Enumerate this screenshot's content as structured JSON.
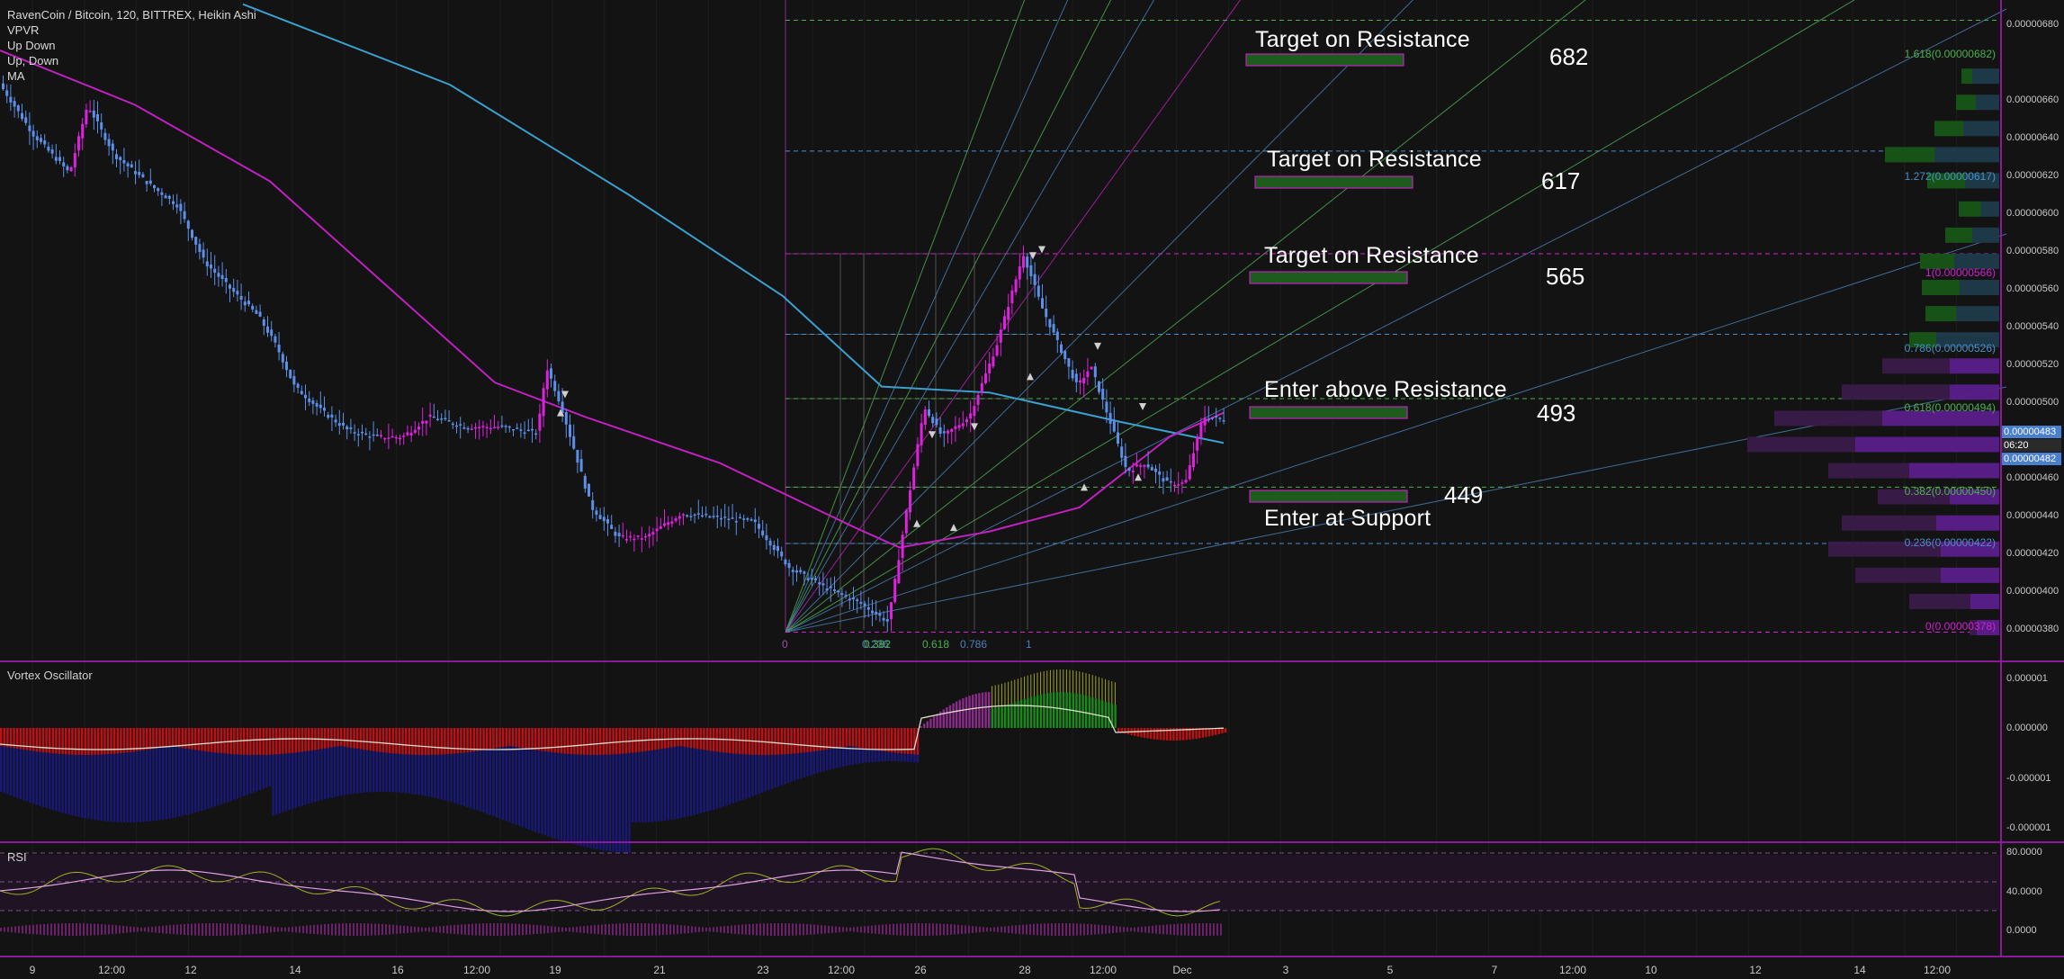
{
  "title": "RavenCoin / Bitcoin, 120, BITTREX, Heikin Ashi",
  "indicators": [
    "VPVR",
    "Up Down",
    "Up, Down",
    "MA"
  ],
  "panels": {
    "vortex": "Vortex Oscillator",
    "rsi": "RSI"
  },
  "annotations": [
    {
      "text": "Target on Resistance",
      "value": "682"
    },
    {
      "text": "Target on Resistance",
      "value": "617"
    },
    {
      "text": "Target on Resistance",
      "value": "565"
    },
    {
      "text": "Enter above Resistance",
      "value": "493"
    },
    {
      "text": "Enter at Support",
      "value": "449"
    }
  ],
  "fib_levels": [
    {
      "label": "1.618(0.00000682)",
      "price": 682,
      "color": "#4caf50"
    },
    {
      "label": "1.272(0.00000617)",
      "price": 617,
      "color": "#4a90c8"
    },
    {
      "label": "1(0.00000566)",
      "price": 566,
      "color": "#d020d0"
    },
    {
      "label": "0.786(0.00000526)",
      "price": 526,
      "color": "#4a90c8"
    },
    {
      "label": "0.618(0.00000494)",
      "price": 494,
      "color": "#4caf50"
    },
    {
      "label": "0.382(0.00000450)",
      "price": 450,
      "color": "#4caf50"
    },
    {
      "label": "0.236(0.00000422)",
      "price": 422,
      "color": "#4a90c8"
    },
    {
      "label": "0(0.00000378)",
      "price": 378,
      "color": "#d020d0"
    }
  ],
  "fan_labels": [
    "0",
    "0.236",
    "0.382",
    "0.618",
    "0.786",
    "1"
  ],
  "price_axis": [
    "0.00000680",
    "0.00000660",
    "0.00000640",
    "0.00000620",
    "0.00000600",
    "0.00000580",
    "0.00000560",
    "0.00000540",
    "0.00000520",
    "0.00000500",
    "0.00000460",
    "0.00000440",
    "0.00000420",
    "0.00000400",
    "0.00000380"
  ],
  "price_tags": {
    "last": "0.00000483",
    "timer": "06:20",
    "prev": "0.00000482"
  },
  "vortex_axis": [
    "0.000001",
    "0.000000",
    "-0.000001",
    "-0.000001"
  ],
  "rsi_axis": [
    "80.0000",
    "40.0000",
    "0.0000"
  ],
  "date_axis": [
    "9",
    "12:00",
    "12",
    "14",
    "16",
    "12:00",
    "19",
    "21",
    "23",
    "12:00",
    "26",
    "28",
    "12:00",
    "Dec",
    "3",
    "5",
    "7",
    "12:00",
    "10",
    "12",
    "14",
    "12:00"
  ],
  "colors": {
    "bull": "#e020e0",
    "bear": "#5b8fe8",
    "ma_slow": "#3aa0d0",
    "ma_fast": "#c020c0",
    "vortex_pos": "#1a8a1a",
    "vortex_neg_red": "#c01010",
    "vortex_neg_blue": "#18187a",
    "separator": "#8a1a9a"
  },
  "chart_data": {
    "type": "candlestick",
    "title": "RavenCoin / Bitcoin, 120, BITTREX, Heikin Ashi",
    "ylim": [
      372,
      696
    ],
    "y_unit": "satoshi (x 0.00000001 BTC)",
    "x": [
      "9",
      "12:00",
      "12",
      "14",
      "16",
      "12:00",
      "19",
      "21",
      "23",
      "12:00",
      "26",
      "28",
      "12:00",
      "Dec"
    ],
    "close_path": [
      [
        0,
        652
      ],
      [
        40,
        625
      ],
      [
        80,
        606
      ],
      [
        100,
        640
      ],
      [
        130,
        615
      ],
      [
        170,
        600
      ],
      [
        200,
        590
      ],
      [
        230,
        562
      ],
      [
        260,
        548
      ],
      [
        290,
        535
      ],
      [
        310,
        520
      ],
      [
        330,
        500
      ],
      [
        360,
        488
      ],
      [
        390,
        478
      ],
      [
        420,
        475
      ],
      [
        450,
        475
      ],
      [
        480,
        485
      ],
      [
        520,
        480
      ],
      [
        560,
        480
      ],
      [
        600,
        477
      ],
      [
        610,
        510
      ],
      [
        625,
        492
      ],
      [
        640,
        470
      ],
      [
        660,
        440
      ],
      [
        690,
        425
      ],
      [
        720,
        425
      ],
      [
        760,
        437
      ],
      [
        800,
        435
      ],
      [
        840,
        433
      ],
      [
        880,
        410
      ],
      [
        920,
        400
      ],
      [
        960,
        392
      ],
      [
        990,
        383
      ],
      [
        1010,
        438
      ],
      [
        1030,
        490
      ],
      [
        1050,
        475
      ],
      [
        1080,
        485
      ],
      [
        1110,
        520
      ],
      [
        1140,
        566
      ],
      [
        1160,
        540
      ],
      [
        1180,
        520
      ],
      [
        1200,
        500
      ],
      [
        1215,
        510
      ],
      [
        1240,
        478
      ],
      [
        1255,
        458
      ],
      [
        1275,
        462
      ],
      [
        1300,
        452
      ],
      [
        1320,
        452
      ],
      [
        1340,
        485
      ],
      [
        1360,
        484
      ]
    ],
    "moving_averages": [
      {
        "points": [
          [
            270,
            690
          ],
          [
            500,
            650
          ],
          [
            700,
            595
          ],
          [
            870,
            545
          ],
          [
            980,
            500
          ],
          [
            1100,
            497
          ],
          [
            1250,
            482
          ],
          [
            1360,
            472
          ]
        ]
      },
      {
        "points": [
          [
            0,
            667
          ],
          [
            150,
            640
          ],
          [
            300,
            602
          ],
          [
            450,
            542
          ],
          [
            550,
            502
          ],
          [
            650,
            485
          ],
          [
            800,
            462
          ],
          [
            950,
            430
          ],
          [
            1000,
            420
          ],
          [
            1100,
            428
          ],
          [
            1200,
            440
          ],
          [
            1300,
            475
          ],
          [
            1360,
            487
          ]
        ]
      }
    ],
    "fib_levels": [
      682,
      617,
      566,
      526,
      494,
      450,
      422,
      378
    ],
    "volume_profile": [
      {
        "price": 654,
        "up": 30,
        "down": 12
      },
      {
        "price": 641,
        "up": 26,
        "down": 22
      },
      {
        "price": 628,
        "up": 40,
        "down": 32
      },
      {
        "price": 615,
        "up": 72,
        "down": 55
      },
      {
        "price": 602,
        "up": 38,
        "down": 42
      },
      {
        "price": 588,
        "up": 20,
        "down": 25
      },
      {
        "price": 575,
        "up": 30,
        "down": 30
      },
      {
        "price": 562,
        "up": 50,
        "down": 38
      },
      {
        "price": 549,
        "up": 44,
        "down": 42
      },
      {
        "price": 536,
        "up": 48,
        "down": 34
      },
      {
        "price": 523,
        "up": 70,
        "down": 30
      },
      {
        "price": 510,
        "up": 55,
        "down": 75
      },
      {
        "price": 497,
        "up": 55,
        "down": 120
      },
      {
        "price": 484,
        "up": 130,
        "down": 120
      },
      {
        "price": 471,
        "up": 160,
        "down": 120
      },
      {
        "price": 458,
        "up": 100,
        "down": 90
      },
      {
        "price": 445,
        "up": 55,
        "down": 80
      },
      {
        "price": 432,
        "up": 70,
        "down": 105
      },
      {
        "price": 419,
        "up": 65,
        "down": 125
      },
      {
        "price": 406,
        "up": 65,
        "down": 95
      },
      {
        "price": 393,
        "up": 32,
        "down": 68
      },
      {
        "price": 380,
        "up": 25,
        "down": 8
      }
    ]
  }
}
